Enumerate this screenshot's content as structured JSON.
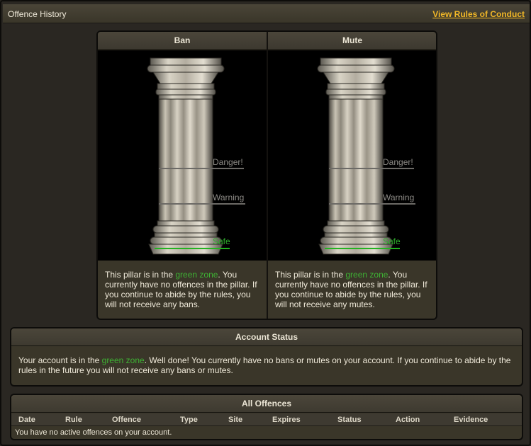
{
  "header": {
    "title": "Offence History",
    "rules_link": "View Rules of Conduct"
  },
  "pillars": [
    {
      "title": "Ban",
      "levels": {
        "danger": "Danger!",
        "warning": "Warning",
        "safe": "Safe"
      },
      "zone": "green zone",
      "desc_pre": "This pillar is in the ",
      "desc_post": ". You currently have no offences in the pillar. If you continue to abide by the rules, you will not receive any bans."
    },
    {
      "title": "Mute",
      "levels": {
        "danger": "Danger!",
        "warning": "Warning",
        "safe": "Safe"
      },
      "zone": "green zone",
      "desc_pre": "This pillar is in the ",
      "desc_post": ". You currently have no offences in the pillar. If you continue to abide by the rules, you will not receive any mutes."
    }
  ],
  "account_status": {
    "title": "Account Status",
    "text_pre": "Your account is in the ",
    "zone": "green zone",
    "text_post": ". Well done! You currently have no bans or mutes on your account. If you continue to abide by the rules in the future you will not receive any bans or mutes."
  },
  "offences": {
    "title": "All Offences",
    "columns": [
      "Date",
      "Rule",
      "Offence",
      "Type",
      "Site",
      "Expires",
      "Status",
      "Action",
      "Evidence"
    ],
    "empty_message": "You have no active offences on your account."
  },
  "colors": {
    "zone_green": "#3eb234",
    "link_gold": "#f2b827",
    "panel_bg": "#3a3629"
  }
}
